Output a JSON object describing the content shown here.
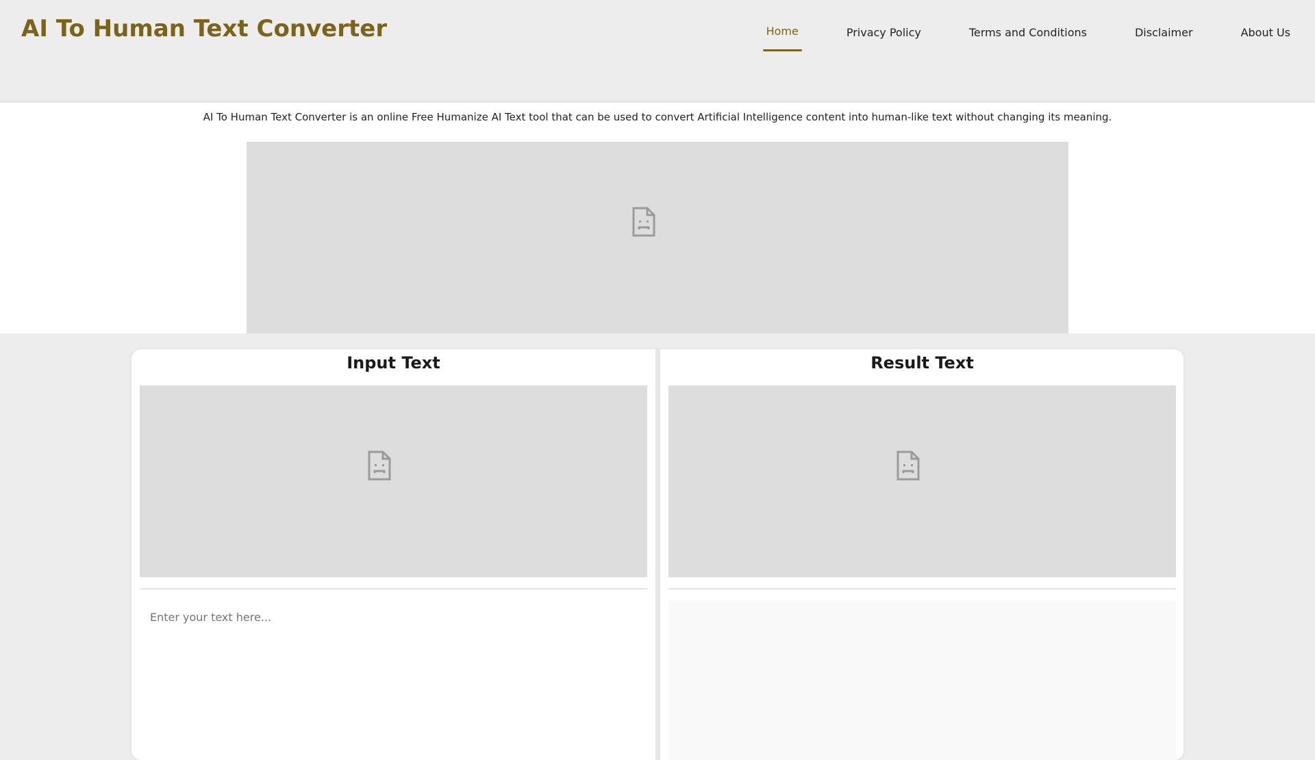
{
  "site": {
    "title": "AI To Human Text Converter"
  },
  "nav": {
    "items": [
      {
        "label": "Home",
        "active": true
      },
      {
        "label": "Privacy Policy",
        "active": false
      },
      {
        "label": "Terms and Conditions",
        "active": false
      },
      {
        "label": "Disclaimer",
        "active": false
      },
      {
        "label": "About Us",
        "active": false
      }
    ]
  },
  "description": "AI To Human Text Converter is an online Free Humanize AI Text tool that can be used to convert Artificial Intelligence content into human-like text without changing its meaning.",
  "converter": {
    "input_title": "Input Text",
    "input_placeholder": "Enter your text here...",
    "input_value": "",
    "result_title": "Result Text",
    "result_value": ""
  },
  "icons": {
    "broken_image": "broken-image-icon"
  },
  "colors": {
    "brand": "#7a6419",
    "page_background": "#ededed",
    "ad_placeholder": "#dddddd"
  }
}
